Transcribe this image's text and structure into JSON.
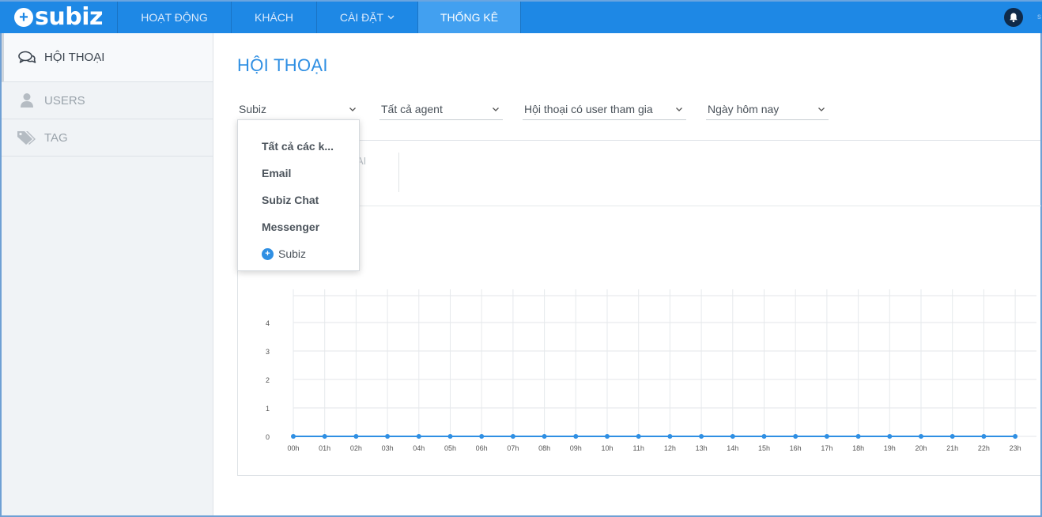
{
  "brand": {
    "name": "subiz",
    "mark": "+"
  },
  "nav": {
    "items": [
      {
        "label": "HOẠT ĐỘNG"
      },
      {
        "label": "KHÁCH"
      },
      {
        "label": "CÀI ĐẶT"
      },
      {
        "label": "THỐNG KÊ"
      }
    ],
    "active_index": 3,
    "settings_caret": "⌄",
    "right_edge_glyph": "s"
  },
  "sidebar": {
    "items": [
      {
        "label": "HỘI THOẠI",
        "icon": "chat-bubbles-icon"
      },
      {
        "label": "USERS",
        "icon": "user-icon"
      },
      {
        "label": "TAG",
        "icon": "tags-icon"
      }
    ]
  },
  "page": {
    "title": "HỘI THOẠI"
  },
  "filters": {
    "channel": "Subiz",
    "agent": "Tất cả agent",
    "conversation_type": "Hội thoại có user tham gia",
    "date_range": "Ngày hôm nay"
  },
  "dropdown": {
    "options": [
      "Tất cả các k...",
      "Email",
      "Subiz Chat",
      "Messenger"
    ],
    "brand_option": "Subiz"
  },
  "stats": {
    "partial_label": "AI"
  },
  "chart_data": {
    "type": "line",
    "categories": [
      "00h",
      "01h",
      "02h",
      "03h",
      "04h",
      "05h",
      "06h",
      "07h",
      "08h",
      "09h",
      "10h",
      "11h",
      "12h",
      "13h",
      "14h",
      "15h",
      "16h",
      "17h",
      "18h",
      "19h",
      "20h",
      "21h",
      "22h",
      "23h"
    ],
    "series": [
      {
        "name": "Tất cả agent",
        "values": [
          0,
          0,
          0,
          0,
          0,
          0,
          0,
          0,
          0,
          0,
          0,
          0,
          0,
          0,
          0,
          0,
          0,
          0,
          0,
          0,
          0,
          0,
          0,
          0
        ]
      }
    ],
    "yticks": [
      0,
      1,
      2,
      3,
      4
    ],
    "ylim": [
      0,
      5
    ],
    "grid": true,
    "legend": "bottom",
    "color": "#2f8fe3"
  },
  "colors": {
    "nav_bg": "#1e88e5",
    "nav_active": "#42a0f0",
    "accent": "#2f8fe3",
    "sidebar_bg": "#f0f3f6"
  }
}
